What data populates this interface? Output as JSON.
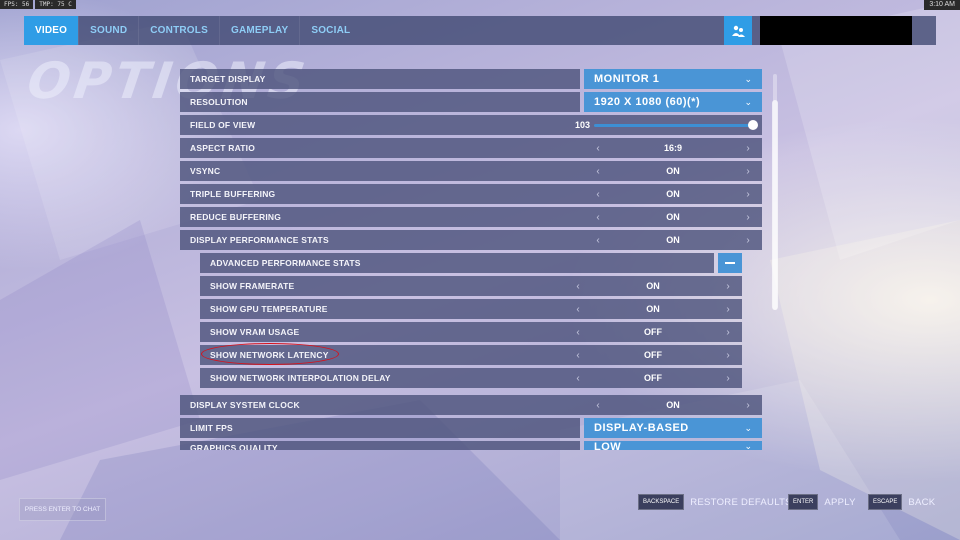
{
  "os": {
    "fps": "FPS: 56",
    "tmp": "TMP: 75 C",
    "clock": "3:10 AM"
  },
  "nav": {
    "tabs": [
      {
        "label": "VIDEO",
        "active": true
      },
      {
        "label": "SOUND"
      },
      {
        "label": "CONTROLS"
      },
      {
        "label": "GAMEPLAY"
      },
      {
        "label": "SOCIAL"
      }
    ],
    "social_icon": "social-group-icon"
  },
  "page_title": "OPTIONS",
  "settings": {
    "target_display": {
      "label": "TARGET DISPLAY",
      "value": "MONITOR 1"
    },
    "resolution": {
      "label": "RESOLUTION",
      "value": "1920 X 1080 (60)(*)"
    },
    "field_of_view": {
      "label": "FIELD OF VIEW",
      "value": "103",
      "level": 1.0
    },
    "aspect_ratio": {
      "label": "ASPECT RATIO",
      "value": "16:9"
    },
    "vsync": {
      "label": "VSYNC",
      "value": "ON"
    },
    "triple_buffering": {
      "label": "TRIPLE BUFFERING",
      "value": "ON"
    },
    "reduce_buffering": {
      "label": "REDUCE BUFFERING",
      "value": "ON"
    },
    "display_performance_stats": {
      "label": "DISPLAY PERFORMANCE STATS",
      "value": "ON"
    },
    "advanced_performance_stats": {
      "label": "ADVANCED PERFORMANCE STATS"
    },
    "show_framerate": {
      "label": "SHOW FRAMERATE",
      "value": "ON"
    },
    "show_gpu_temperature": {
      "label": "SHOW GPU TEMPERATURE",
      "value": "ON"
    },
    "show_vram_usage": {
      "label": "SHOW VRAM USAGE",
      "value": "OFF"
    },
    "show_network_latency": {
      "label": "SHOW NETWORK LATENCY",
      "value": "OFF"
    },
    "show_network_interpolation_delay": {
      "label": "SHOW NETWORK INTERPOLATION DELAY",
      "value": "OFF"
    },
    "display_system_clock": {
      "label": "DISPLAY SYSTEM CLOCK",
      "value": "ON"
    },
    "limit_fps": {
      "label": "LIMIT FPS",
      "value": "DISPLAY-BASED"
    },
    "graphics_quality": {
      "label": "GRAPHICS QUALITY",
      "value": "LOW"
    }
  },
  "footer": {
    "chat": "PRESS ENTER TO CHAT",
    "restore_key": "BACKSPACE",
    "restore_label": "RESTORE DEFAULTS",
    "apply_key": "ENTER",
    "apply_label": "APPLY",
    "back_key": "ESCAPE",
    "back_label": "BACK"
  },
  "colors": {
    "accent": "#2f9de6",
    "row_bg": "#4e547c",
    "highlight_ring": "#d8111a"
  }
}
